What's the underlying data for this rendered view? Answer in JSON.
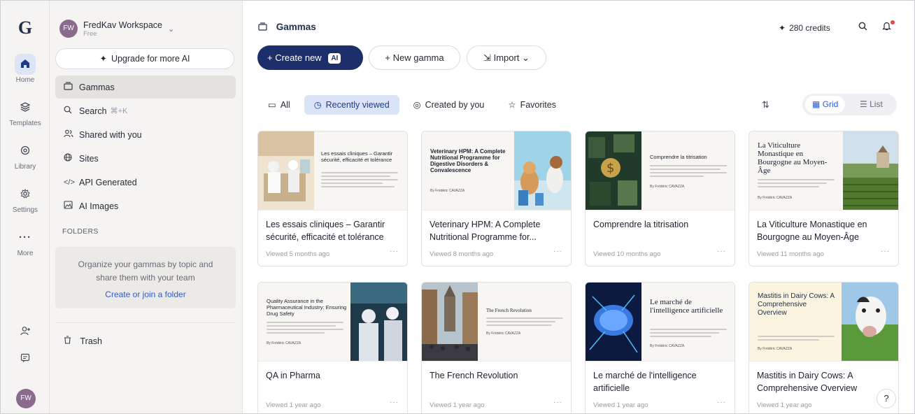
{
  "rail": {
    "logo": "G",
    "items": [
      {
        "label": "Home",
        "icon": "home-icon"
      },
      {
        "label": "Templates",
        "icon": "templates-icon"
      },
      {
        "label": "Library",
        "icon": "library-icon"
      },
      {
        "label": "Settings",
        "icon": "settings-icon"
      },
      {
        "label": "More",
        "icon": "more-icon"
      }
    ],
    "avatar": "FW"
  },
  "sidebar": {
    "workspace_name": "FredKav Workspace",
    "workspace_plan": "Free",
    "avatar": "FW",
    "upgrade_label": "Upgrade for more AI",
    "nav": [
      {
        "label": "Gammas"
      },
      {
        "label": "Search",
        "hint": "⌘+K"
      },
      {
        "label": "Shared with you"
      },
      {
        "label": "Sites"
      },
      {
        "label": "API Generated"
      },
      {
        "label": "AI Images"
      }
    ],
    "folders_heading": "FOLDERS",
    "folders_desc": "Organize your gammas by topic and share them with your team",
    "folders_link": "Create or join a folder",
    "trash_label": "Trash"
  },
  "header": {
    "title": "Gammas",
    "credits": "280 credits"
  },
  "toolbar": {
    "create_label": "Create new",
    "create_badge": "AI",
    "new_gamma_label": "New gamma",
    "import_label": "Import"
  },
  "filters": {
    "all": "All",
    "recent": "Recently viewed",
    "created": "Created by you",
    "favorites": "Favorites",
    "grid": "Grid",
    "list": "List"
  },
  "cards": [
    {
      "title": "Les essais cliniques – Garantir sécurité, efficacité et tolérance",
      "meta": "Viewed 5 months ago",
      "thumb_title": "Les essais cliniques – Garantir sécurité, efficacité et tolérance",
      "thumb_author": ""
    },
    {
      "title": "Veterinary HPM: A Complete Nutritional Programme for...",
      "meta": "Viewed 8 months ago",
      "thumb_title": "Veterinary HPM: A Complete Nutritional Programme for Digestive Disorders & Convalescence",
      "thumb_author": "By Frédéric CAVAZZA"
    },
    {
      "title": "Comprendre la titrisation",
      "meta": "Viewed 10 months ago",
      "thumb_title": "Comprendre la titrisation",
      "thumb_author": "By Frédéric CAVAZZA"
    },
    {
      "title": "La Viticulture Monastique en Bourgogne au Moyen-Âge",
      "meta": "Viewed 11 months ago",
      "thumb_title": "La Viticulture Monastique en Bourgogne au Moyen-Âge",
      "thumb_author": "By Frédéric CAVAZZA"
    },
    {
      "title": "QA in Pharma",
      "meta": "Viewed 1 year ago",
      "thumb_title": "Quality Assurance in the Pharmaceutical Industry: Ensuring Drug Safety",
      "thumb_author": "By Frédéric CAVAZZA"
    },
    {
      "title": "The French Revolution",
      "meta": "Viewed 1 year ago",
      "thumb_title": "The French Revolution",
      "thumb_author": "By Frédéric CAVAZZA"
    },
    {
      "title": "Le marché de l'intelligence artificielle",
      "meta": "Viewed 1 year ago",
      "thumb_title": "Le marché de l'intelligence artificielle",
      "thumb_author": "By Frédéric CAVAZZA"
    },
    {
      "title": "Mastitis in Dairy Cows: A Comprehensive Overview",
      "meta": "Viewed 1 year ago",
      "thumb_title": "Mastitis in Dairy Cows: A Comprehensive Overview",
      "thumb_author": "By Frédéric CAVAZZA"
    }
  ],
  "help": "?",
  "colors": {
    "brand": "#1c2f6b",
    "accent": "#2a5bd7",
    "active_filter_bg": "#dbe3f7",
    "sidebar_bg": "#f5f4f2",
    "notification_dot": "#e24848"
  }
}
